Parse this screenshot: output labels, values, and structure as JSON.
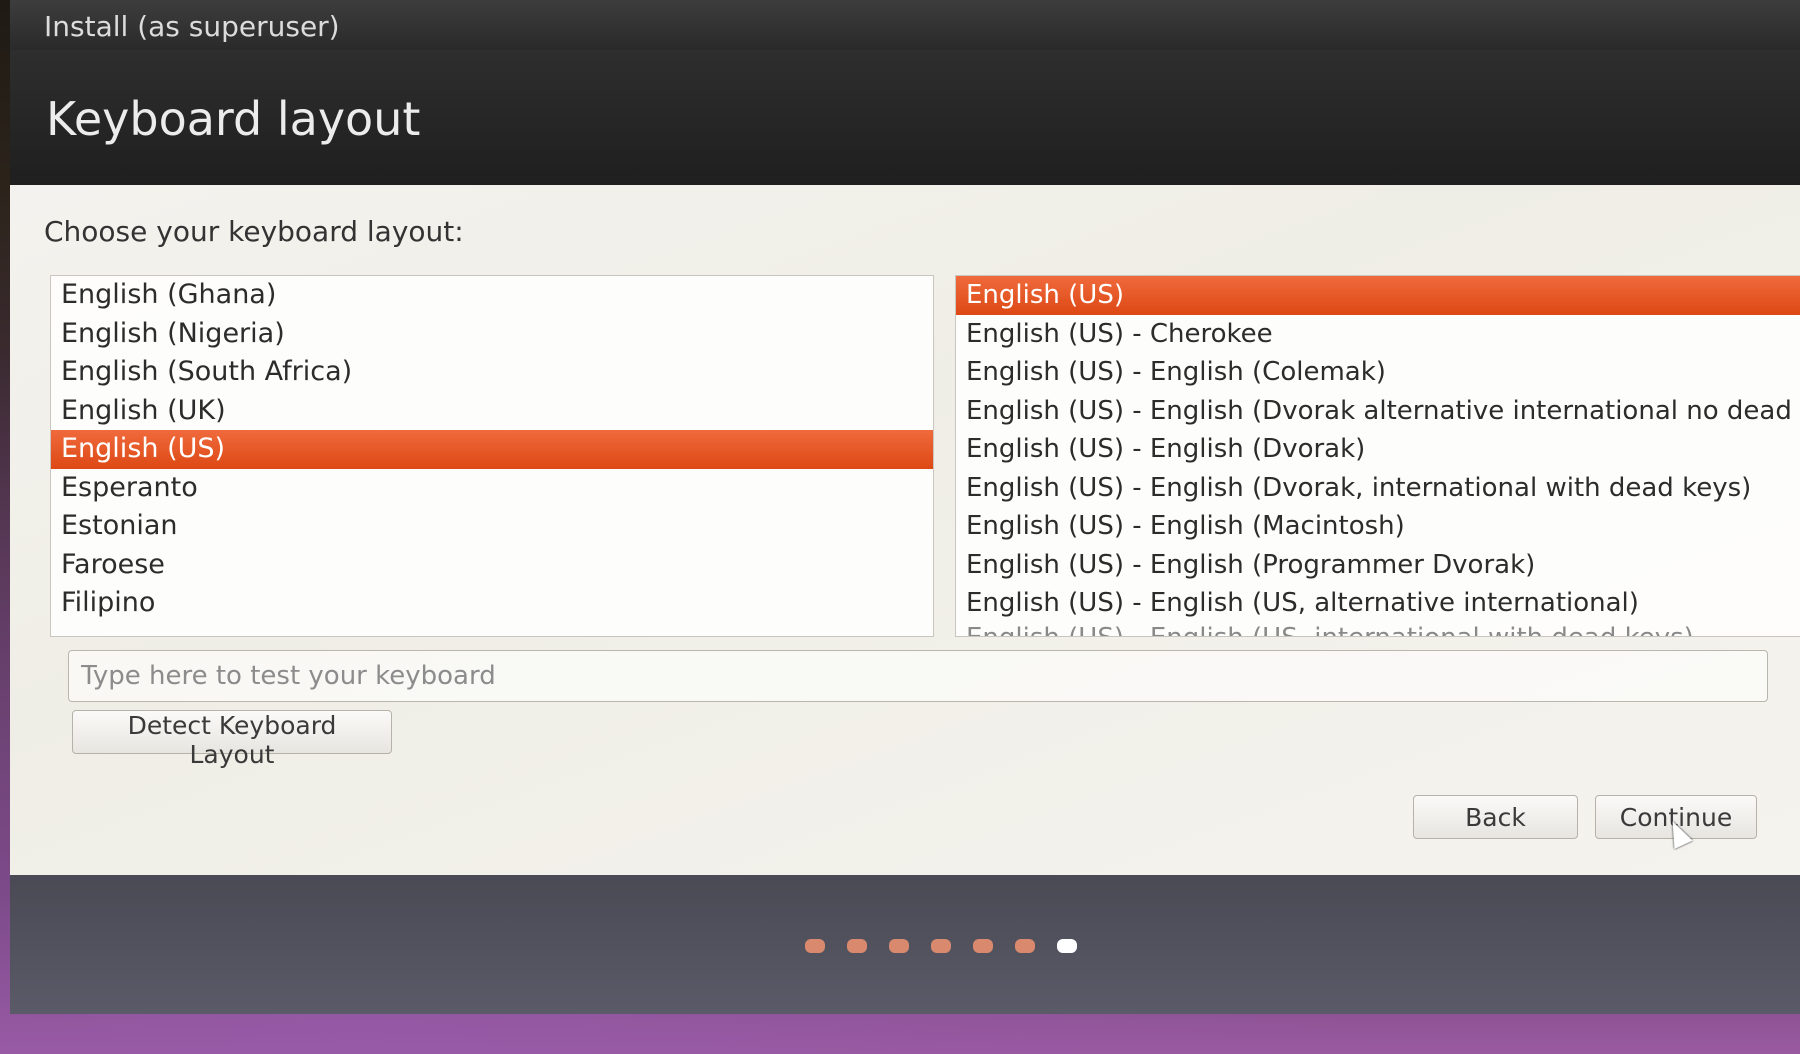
{
  "window": {
    "title": "Install (as superuser)"
  },
  "page": {
    "title": "Keyboard layout",
    "choose_label": "Choose your keyboard layout:"
  },
  "layouts": {
    "items": [
      "English (Ghana)",
      "English (Nigeria)",
      "English (South Africa)",
      "English (UK)",
      "English (US)",
      "Esperanto",
      "Estonian",
      "Faroese",
      "Filipino"
    ],
    "selected": "English (US)"
  },
  "variants": {
    "items": [
      "English (US)",
      "English (US) - Cherokee",
      "English (US) - English (Colemak)",
      "English (US) - English (Dvorak alternative international no dead keys)",
      "English (US) - English (Dvorak)",
      "English (US) - English (Dvorak, international with dead keys)",
      "English (US) - English (Macintosh)",
      "English (US) - English (Programmer Dvorak)",
      "English (US) - English (US, alternative international)",
      "English (US) - English (US, international with dead keys)"
    ],
    "selected": "English (US)"
  },
  "test_field": {
    "placeholder": "Type here to test your keyboard",
    "value": ""
  },
  "buttons": {
    "detect": "Detect Keyboard Layout",
    "back": "Back",
    "continue": "Continue"
  },
  "progress": {
    "total_steps": 7,
    "current_step": 7
  },
  "colors": {
    "accent": "#dd4814",
    "header_bg": "#1f1f1f",
    "footer_bg": "#4f4f5c"
  }
}
